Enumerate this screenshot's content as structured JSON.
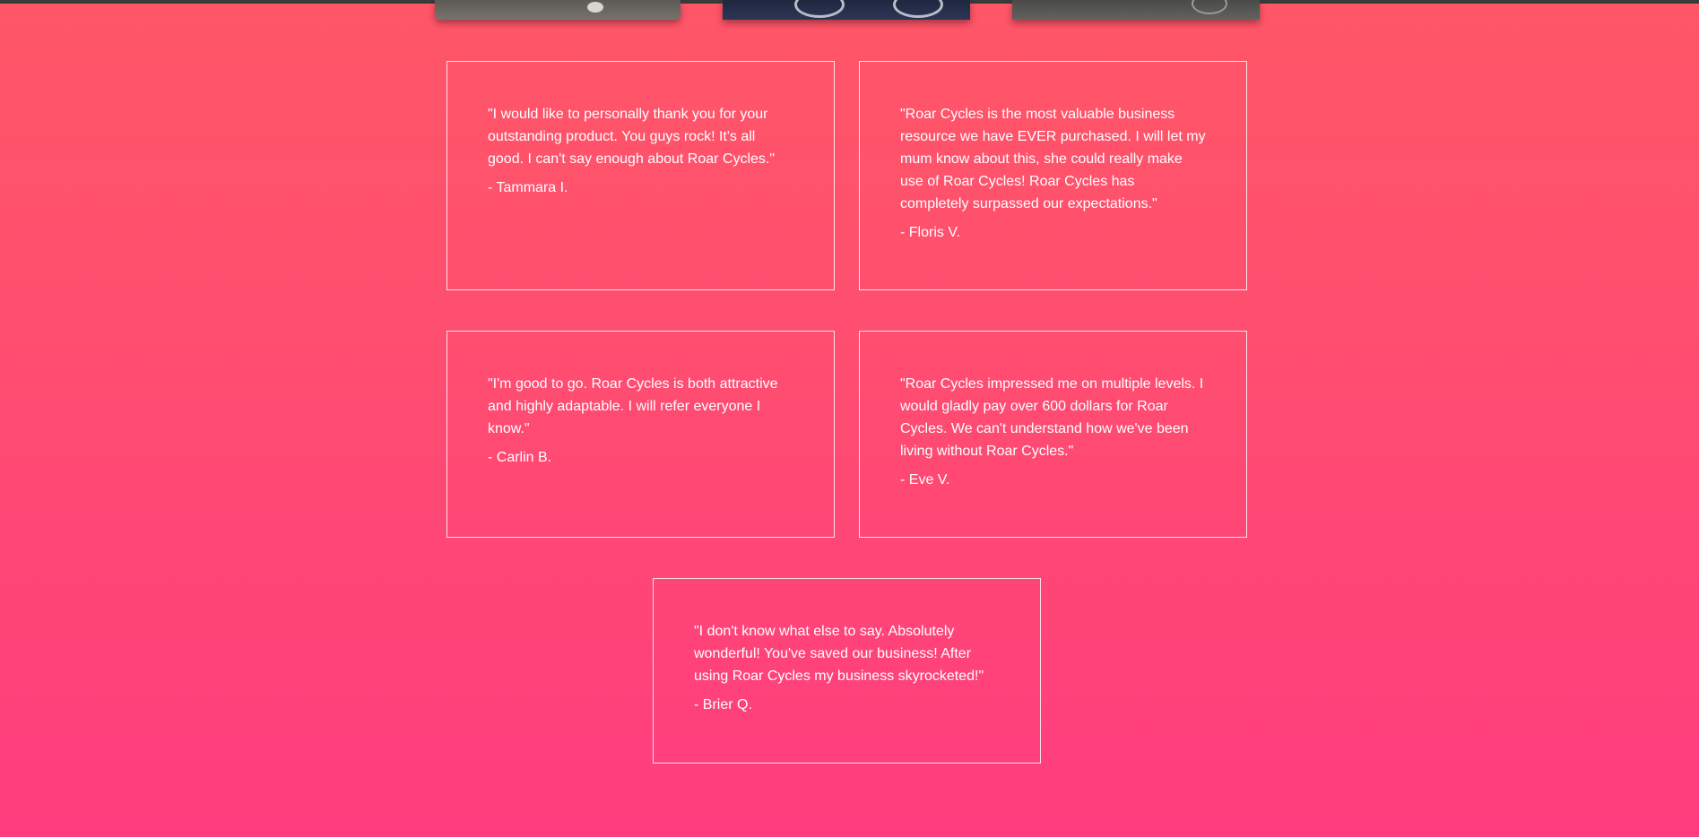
{
  "colors": {
    "background_top": "#ff5667",
    "background_bottom": "#ff3d7f",
    "card_border": "#ffffff",
    "text": "#ffffff"
  },
  "gallery": {
    "items": [
      {
        "name": "bike-photo-1"
      },
      {
        "name": "bike-photo-2"
      },
      {
        "name": "bike-photo-3"
      }
    ]
  },
  "testimonials": [
    {
      "quote": "\"I would like to personally thank you for your outstanding product. You guys rock! It's all good. I can't say enough about Roar Cycles.\"",
      "author": "- Tammara I."
    },
    {
      "quote": "\"Roar Cycles is the most valuable business resource we have EVER purchased. I will let my mum know about this, she could really make use of Roar Cycles! Roar Cycles has completely surpassed our expectations.\"",
      "author": "- Floris V."
    },
    {
      "quote": "\"I'm good to go. Roar Cycles is both attractive and highly adaptable. I will refer everyone I know.\"",
      "author": "- Carlin B."
    },
    {
      "quote": "\"Roar Cycles impressed me on multiple levels. I would gladly pay over 600 dollars for Roar Cycles. We can't understand how we've been living without Roar Cycles.\"",
      "author": "- Eve V."
    },
    {
      "quote": "\"I don't know what else to say. Absolutely wonderful! You've saved our business! After using Roar Cycles my business skyrocketed!\"",
      "author": "- Brier Q."
    }
  ]
}
